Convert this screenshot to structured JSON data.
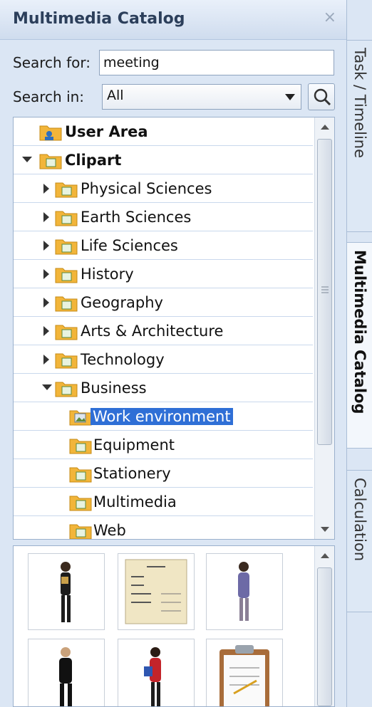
{
  "panel": {
    "title": "Multimedia Catalog",
    "close_glyph": "×"
  },
  "search": {
    "label": "Search for:",
    "value": "meeting",
    "in_label": "Search in:",
    "in_value": "All",
    "button_icon": "search-icon"
  },
  "tree": {
    "items": [
      {
        "label": "User Area"
      },
      {
        "label": "Clipart"
      },
      {
        "label": "Physical Sciences"
      },
      {
        "label": "Earth Sciences"
      },
      {
        "label": "Life Sciences"
      },
      {
        "label": "History"
      },
      {
        "label": "Geography"
      },
      {
        "label": "Arts & Architecture"
      },
      {
        "label": "Technology"
      },
      {
        "label": "Business"
      },
      {
        "label": "Work environment"
      },
      {
        "label": "Equipment"
      },
      {
        "label": "Stationery"
      },
      {
        "label": "Multimedia"
      },
      {
        "label": "Web"
      }
    ]
  },
  "thumbnails": [
    {
      "icon": "businesswoman-with-clipboard-icon"
    },
    {
      "icon": "invoice-document-icon"
    },
    {
      "icon": "businesswoman-walking-icon"
    },
    {
      "icon": "businessman-walking-icon"
    },
    {
      "icon": "woman-with-red-bag-icon"
    },
    {
      "icon": "clipboard-checklist-icon"
    }
  ],
  "tabs": [
    {
      "label": "Task / Timeline"
    },
    {
      "label": "Multimedia Catalog"
    },
    {
      "label": "Calculation"
    }
  ],
  "colors": {
    "selection": "#2f6fd6",
    "panel_bg": "#dbe6f4",
    "folder": "#f0b429"
  }
}
